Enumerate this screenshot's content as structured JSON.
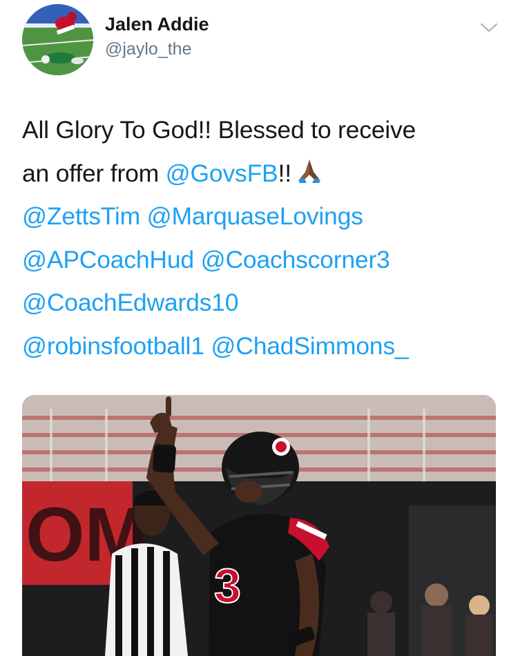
{
  "tweet": {
    "author": {
      "display_name": "Jalen Addie",
      "handle": "@jaylo_the",
      "avatar_icon": "football-player-photo"
    },
    "menu_icon": "chevron-down-icon",
    "text_lines": [
      [
        {
          "t": "All Glory To God!! Blessed to receive"
        }
      ],
      [
        {
          "t": "an offer from "
        },
        {
          "t": "@GovsFB",
          "mention": true
        },
        {
          "t": "!!"
        },
        {
          "emoji": "folded-hands"
        }
      ],
      [
        {
          "t": "@ZettsTim",
          "mention": true
        },
        {
          "t": " "
        },
        {
          "t": "@MarquaseLovings",
          "mention": true
        }
      ],
      [
        {
          "t": "@APCoachHud",
          "mention": true
        },
        {
          "t": " "
        },
        {
          "t": "@Coachscorner3",
          "mention": true
        }
      ],
      [
        {
          "t": "@CoachEdwards10",
          "mention": true
        }
      ],
      [
        {
          "t": "@robinsfootball1",
          "mention": true
        },
        {
          "t": " "
        },
        {
          "t": "@ChadSimmons_",
          "mention": true
        }
      ]
    ],
    "media": {
      "description_icon": "football-celebration-photo",
      "jersey_number": "3",
      "banner_text": "OM"
    }
  },
  "colors": {
    "mention": "#1da1f2",
    "text": "#14171a",
    "secondary": "#657786",
    "chevron": "#aab8c2"
  }
}
